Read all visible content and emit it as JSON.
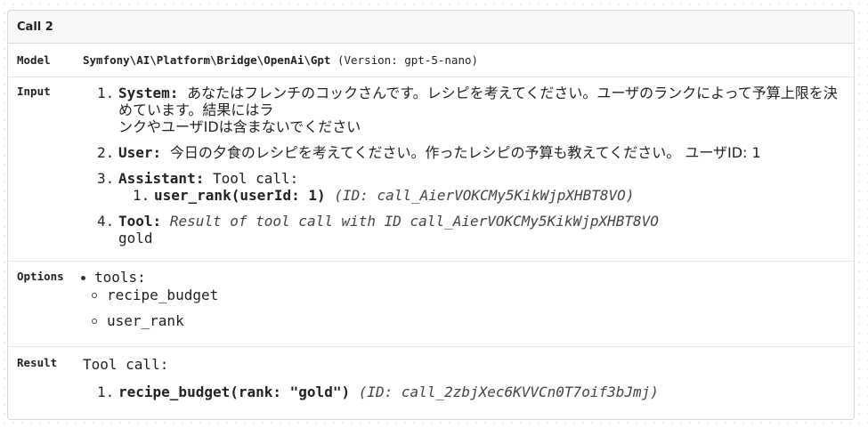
{
  "card": {
    "title": "Call 2"
  },
  "model": {
    "label": "Model",
    "name": "Symfony\\AI\\Platform\\Bridge\\OpenAi\\Gpt",
    "version": "(Version: gpt-5-nano)"
  },
  "input": {
    "label": "Input",
    "messages": [
      {
        "num": "1.",
        "role": "System:",
        "text_line1": "あなたはフレンチのコックさんです。レシピを考えてください。ユーザのランクによって予算上限を決めています。結果にはラ",
        "text_line2": "ンクやユーザIDは含まないでください"
      },
      {
        "num": "2.",
        "role": "User:",
        "text": "今日の夕食のレシピを考えてください。作ったレシピの予算も教えてください。 ユーザID: 1"
      },
      {
        "num": "3.",
        "role": "Assistant:",
        "text": "Tool call:",
        "calls": [
          {
            "num": "1.",
            "call": "user_rank(userId: 1)",
            "id": "(ID: call_AierVOKCMy5KikWjpXHBT8VO)"
          }
        ]
      },
      {
        "num": "4.",
        "role": "Tool:",
        "text": "Result of tool call with ID call_AierVOKCMy5KikWjpXHBT8VO",
        "result": "gold"
      }
    ]
  },
  "options": {
    "label": "Options",
    "key": "tools:",
    "tools": [
      "recipe_budget",
      "user_rank"
    ]
  },
  "result": {
    "label": "Result",
    "head": "Tool call:",
    "calls": [
      {
        "num": "1.",
        "call": "recipe_budget(rank: \"gold\")",
        "id": "(ID: call_2zbjXec6KVVCn0T7oif3bJmj)"
      }
    ]
  }
}
